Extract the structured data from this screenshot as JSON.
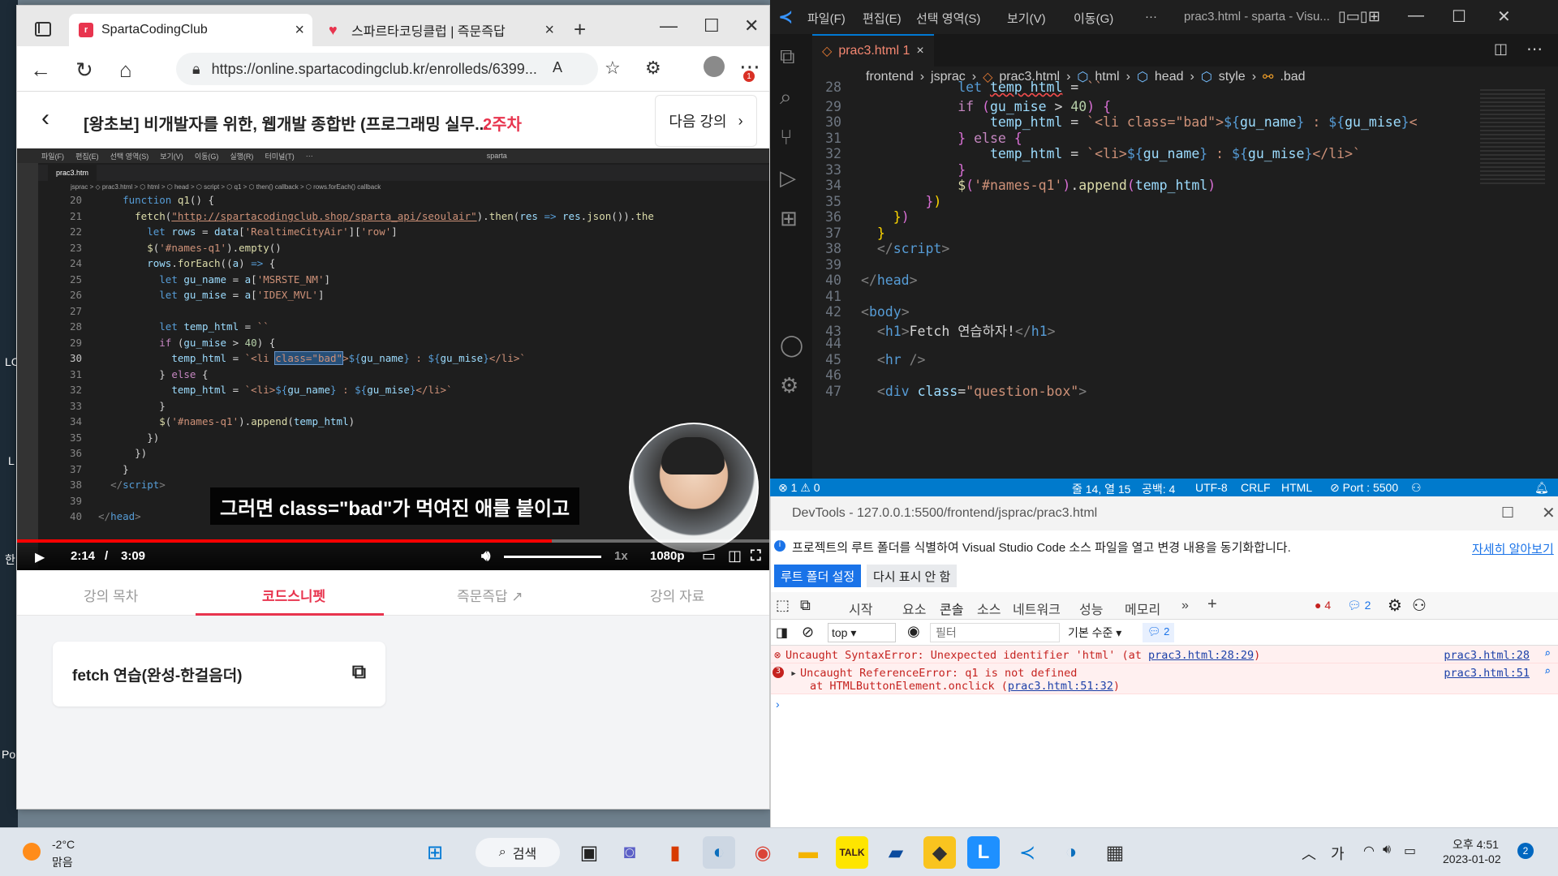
{
  "edge": {
    "tabs": [
      {
        "title": "SpartaCodingClub",
        "favicon": "r"
      },
      {
        "title": "스파르타코딩클럽 | 즉문즉답",
        "favicon": "heart"
      }
    ],
    "url": "https://online.spartacodingclub.kr/enrolleds/6399...",
    "course_title": "[왕초보] 비개발자를 위한, 웹개발 종합반 (프로그래밍 실무...",
    "week": "2주차",
    "next_lecture": "다음 강의",
    "badge": "1",
    "lecture_tabs": [
      "강의 목차",
      "코드스니펫",
      "즉문즉답",
      "강의 자료"
    ],
    "snippet": "fetch 연습(완성-한걸음더)"
  },
  "video": {
    "menu": [
      "파일(F)",
      "편집(E)",
      "선택 영역(S)",
      "보기(V)",
      "이동(G)",
      "실행(R)",
      "터미널(T)",
      "···"
    ],
    "search": "sparta",
    "tab": "prac3.htm",
    "breadcrumb": "jsprac > ◇ prac3.html > ⬡ html > ⬡ head > ⬡ script > ⬡ q1 > ⬡ then() callback > ⬡ rows.forEach() callback",
    "subtitle": "그러면 class=\"bad\"가 먹여진 애를 붙이고",
    "time_current": "2:14",
    "time_total": "3:09",
    "speed": "1x",
    "quality": "1080p",
    "progress": 0.709
  },
  "vscode": {
    "menu": [
      "파일(F)",
      "편집(E)",
      "선택 영역(S)",
      "보기(V)",
      "이동(G)",
      "···"
    ],
    "title": "prac3.html - sparta - Visu...",
    "tab": "prac3.html 1",
    "breadcrumb": [
      "frontend",
      "jsprac",
      "prac3.html",
      "html",
      "head",
      "style",
      ".bad"
    ],
    "status": {
      "problems": "⊗ 1 ⚠ 0",
      "position": "줄 14, 열 15",
      "spaces": "공백: 4",
      "encoding": "UTF-8",
      "eol": "CRLF",
      "language": "HTML",
      "port": "⊘ Port : 5500"
    }
  },
  "devtools": {
    "title": "DevTools - 127.0.0.1:5500/frontend/jsprac/prac3.html",
    "info": "프로젝트의 루트 폴더를 식별하여 Visual Studio Code 소스 파일을 열고 변경 내용을 동기화합니다.",
    "learn_more": "자세히 알아보기",
    "set_root": "루트 폴더 설정",
    "dont_show": "다시 표시 안 함",
    "tabs": [
      "시작",
      "요소",
      "콘솔",
      "소스",
      "네트워크",
      "성능",
      "메모리"
    ],
    "error_count": "4",
    "message_count": "2",
    "context": "top",
    "filter_placeholder": "필터",
    "level": "기본 수준",
    "issues": "2",
    "errors": [
      {
        "text": "Uncaught SyntaxError: Unexpected identifier 'html' (at ",
        "loc": "prac3.html:28:29",
        "tail": ")",
        "link": "prac3.html:28"
      },
      {
        "count": "3",
        "text": "Uncaught ReferenceError: q1 is not defined",
        "text2": "at HTMLButtonElement.onclick (",
        "loc": "prac3.html:51:32",
        "tail": ")",
        "link": "prac3.html:51"
      }
    ]
  },
  "taskbar": {
    "weather_temp": "-2°C",
    "weather_desc": "맑음",
    "search": "검색",
    "ime": "가",
    "time": "오후 4:51",
    "date": "2023-01-02",
    "notifications": "2"
  },
  "desktop_labels": [
    "LC",
    "L",
    "한",
    "Po"
  ]
}
